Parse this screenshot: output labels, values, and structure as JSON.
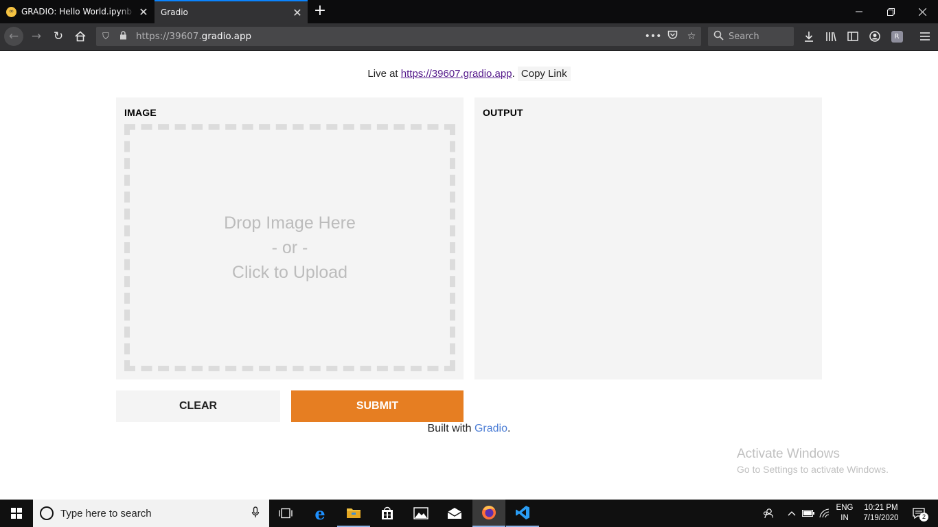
{
  "browser": {
    "tabs": [
      {
        "title": "GRADIO: Hello World.ipynb - C",
        "favicon": "colab-icon",
        "active": false
      },
      {
        "title": "Gradio",
        "active": true
      }
    ],
    "url_prefix": "https://39607.",
    "url_host": "gradio.app",
    "search_placeholder": "Search",
    "colors": {
      "tabbar": "#0c0c0d",
      "toolbar": "#323234",
      "active_tab_accent": "#0a84ff"
    }
  },
  "page": {
    "live_prefix": "Live at ",
    "live_url": "https://39607.gradio.app",
    "live_suffix": ".",
    "copy_link": "Copy Link",
    "input_label": "IMAGE",
    "drop_line1": "Drop Image Here",
    "drop_line2": "- or -",
    "drop_line3": "Click to Upload",
    "output_label": "OUTPUT",
    "clear_label": "CLEAR",
    "submit_label": "SUBMIT",
    "built_prefix": "Built with ",
    "built_link": "Gradio",
    "built_suffix": ".",
    "colors": {
      "submit": "#e67e22",
      "panel": "#f4f4f4",
      "gradio_link": "#4e7fd6"
    }
  },
  "watermark": {
    "title": "Activate Windows",
    "subtitle": "Go to Settings to activate Windows."
  },
  "taskbar": {
    "search_placeholder": "Type here to search",
    "lang_line1": "ENG",
    "lang_line2": "IN",
    "time": "10:21 PM",
    "date": "7/19/2020",
    "notification_count": "2"
  }
}
